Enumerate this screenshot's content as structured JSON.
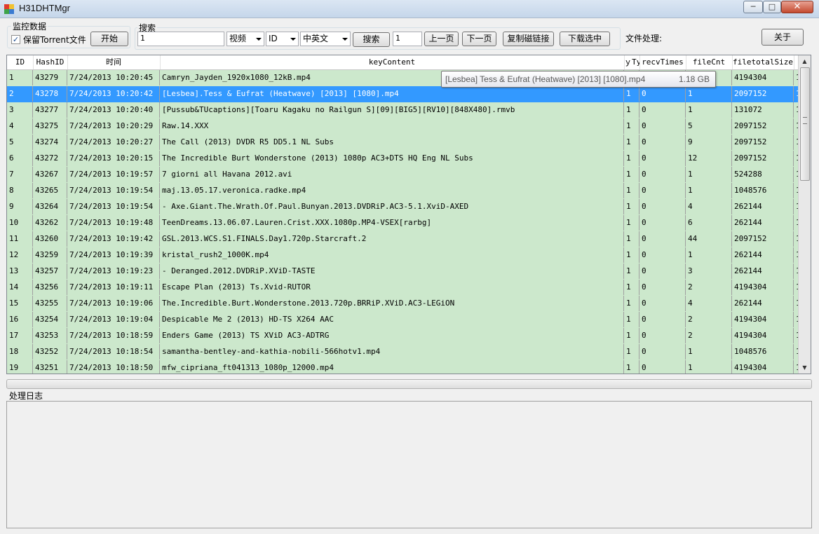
{
  "window": {
    "title": "H31DHTMgr",
    "minimize": "─",
    "maximize": "□",
    "close": "✕"
  },
  "monitor": {
    "legend": "监控数据",
    "keep_torrent_label": "保留Torrent文件",
    "keep_torrent_checked": "✓",
    "start_button": "开始"
  },
  "search": {
    "legend": "搜索",
    "query": "1",
    "type_select": "视频",
    "field_select": "ID",
    "lang_select": "中英文",
    "search_button": "搜索",
    "page_value": "1",
    "prev_button": "上一页",
    "next_button": "下一页",
    "copy_magnet_button": "复制磁链接",
    "download_button": "下载选中"
  },
  "file_processing_label": "文件处理:",
  "about_button": "关于",
  "grid": {
    "columns": [
      "ID",
      "HashID",
      "时间",
      "keyContent",
      "ｙTy",
      "recvTimes",
      "fileCnt",
      "filetotalSize",
      ""
    ],
    "rows": [
      [
        "1",
        "43279",
        "7/24/2013 10:20:45",
        "Camryn_Jayden_1920x1080_12kB.mp4",
        "1",
        "0",
        "1",
        "4194304",
        "1"
      ],
      [
        "2",
        "43278",
        "7/24/2013 10:20:42",
        "[Lesbea].Tess & Eufrat (Heatwave) [2013] [1080].mp4",
        "1",
        "0",
        "1",
        "2097152",
        "1"
      ],
      [
        "3",
        "43277",
        "7/24/2013 10:20:40",
        "[Pussub&TUcaptions][Toaru Kagaku no Railgun S][09][BIG5][RV10][848X480].rmvb",
        "1",
        "0",
        "1",
        "131072",
        "1"
      ],
      [
        "4",
        "43275",
        "7/24/2013 10:20:29",
        "Raw.14.XXX",
        "1",
        "0",
        "5",
        "2097152",
        "1"
      ],
      [
        "5",
        "43274",
        "7/24/2013 10:20:27",
        "The Call (2013) DVDR R5 DD5.1 NL Subs",
        "1",
        "0",
        "9",
        "2097152",
        "1"
      ],
      [
        "6",
        "43272",
        "7/24/2013 10:20:15",
        "The Incredible Burt Wonderstone (2013) 1080p AC3+DTS HQ Eng NL Subs",
        "1",
        "0",
        "12",
        "2097152",
        "1"
      ],
      [
        "7",
        "43267",
        "7/24/2013 10:19:57",
        "7 giorni all Havana 2012.avi",
        "1",
        "0",
        "1",
        "524288",
        "1"
      ],
      [
        "8",
        "43265",
        "7/24/2013 10:19:54",
        "maj.13.05.17.veronica.radke.mp4",
        "1",
        "0",
        "1",
        "1048576",
        "1"
      ],
      [
        "9",
        "43264",
        "7/24/2013 10:19:54",
        "- Axe.Giant.The.Wrath.Of.Paul.Bunyan.2013.DVDRiP.AC3-5.1.XviD-AXED",
        "1",
        "0",
        "4",
        "262144",
        "1"
      ],
      [
        "10",
        "43262",
        "7/24/2013 10:19:48",
        "TeenDreams.13.06.07.Lauren.Crist.XXX.1080p.MP4-VSEX[rarbg]",
        "1",
        "0",
        "6",
        "262144",
        "1"
      ],
      [
        "11",
        "43260",
        "7/24/2013 10:19:42",
        "GSL.2013.WCS.S1.FINALS.Day1.720p.Starcraft.2",
        "1",
        "0",
        "44",
        "2097152",
        "1"
      ],
      [
        "12",
        "43259",
        "7/24/2013 10:19:39",
        "kristal_rush2_1000K.mp4",
        "1",
        "0",
        "1",
        "262144",
        "1"
      ],
      [
        "13",
        "43257",
        "7/24/2013 10:19:23",
        "- Deranged.2012.DVDRiP.XViD-TASTE",
        "1",
        "0",
        "3",
        "262144",
        "1"
      ],
      [
        "14",
        "43256",
        "7/24/2013 10:19:11",
        "Escape Plan (2013) Ts.Xvid-RUTOR",
        "1",
        "0",
        "2",
        "4194304",
        "1"
      ],
      [
        "15",
        "43255",
        "7/24/2013 10:19:06",
        "The.Incredible.Burt.Wonderstone.2013.720p.BRRiP.XViD.AC3-LEGiON",
        "1",
        "0",
        "4",
        "262144",
        "1"
      ],
      [
        "16",
        "43254",
        "7/24/2013 10:19:04",
        "Despicable Me 2 (2013) HD-TS X264 AAC",
        "1",
        "0",
        "2",
        "4194304",
        "1"
      ],
      [
        "17",
        "43253",
        "7/24/2013 10:18:59",
        "Enders Game (2013) TS XViD AC3-ADTRG",
        "1",
        "0",
        "2",
        "4194304",
        "1"
      ],
      [
        "18",
        "43252",
        "7/24/2013 10:18:54",
        "samantha-bentley-and-kathia-nobili-566hotv1.mp4",
        "1",
        "0",
        "1",
        "1048576",
        "1"
      ],
      [
        "19",
        "43251",
        "7/24/2013 10:18:50",
        "mfw_cipriana_ft041313_1080p_12000.mp4",
        "1",
        "0",
        "1",
        "4194304",
        "1"
      ]
    ],
    "selected_row_index": 1
  },
  "tooltip": {
    "name": "[Lesbea] Tess & Eufrat (Heatwave) [2013] [1080].mp4",
    "size": "1.18 GB"
  },
  "log": {
    "label": "处理日志"
  },
  "colors": {
    "row_bg": "#cce8cc",
    "selected_bg": "#3399ff"
  }
}
